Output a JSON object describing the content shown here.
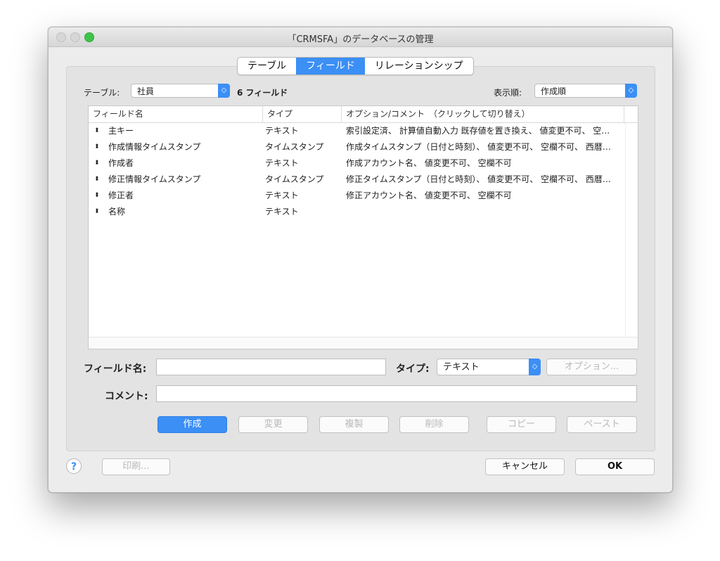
{
  "window": {
    "title": "「CRMSFA」のデータベースの管理"
  },
  "tabs": [
    {
      "label": "テーブル",
      "active": false
    },
    {
      "label": "フィールド",
      "active": true
    },
    {
      "label": "リレーションシップ",
      "active": false
    }
  ],
  "table_selector": {
    "label": "テーブル:",
    "value": "社員",
    "count_text": "6 フィールド"
  },
  "sort": {
    "label": "表示順:",
    "value": "作成順"
  },
  "columns": [
    "フィールド名",
    "タイプ",
    "オプション/コメント　（クリックして切り替え）"
  ],
  "rows": [
    {
      "name": "主キー",
      "type": "テキスト",
      "options": "索引設定済、 計算値自動入力  既存値を置き換え、 値変更不可、 空…"
    },
    {
      "name": "作成情報タイムスタンプ",
      "type": "タイムスタンプ",
      "options": "作成タイムスタンプ（日付と時刻）、 値変更不可、 空欄不可、 西暦…"
    },
    {
      "name": "作成者",
      "type": "テキスト",
      "options": "作成アカウント名、 値変更不可、 空欄不可"
    },
    {
      "name": "修正情報タイムスタンプ",
      "type": "タイムスタンプ",
      "options": "修正タイムスタンプ（日付と時刻）、 値変更不可、 空欄不可、 西暦…"
    },
    {
      "name": "修正者",
      "type": "テキスト",
      "options": "修正アカウント名、 値変更不可、 空欄不可"
    },
    {
      "name": "名称",
      "type": "テキスト",
      "options": ""
    }
  ],
  "row_icon": "⬍",
  "form": {
    "field_name_label": "フィールド名:",
    "field_name_value": "",
    "type_label": "タイプ:",
    "type_value": "テキスト",
    "options_button": "オプション...",
    "comment_label": "コメント:",
    "comment_value": ""
  },
  "actions": [
    "作成",
    "変更",
    "複製",
    "削除",
    "コピー",
    "ペースト"
  ],
  "footer": {
    "help": "?",
    "print": "印刷...",
    "cancel": "キャンセル",
    "ok": "OK"
  },
  "colors": {
    "accent": "#3b8ff5"
  }
}
